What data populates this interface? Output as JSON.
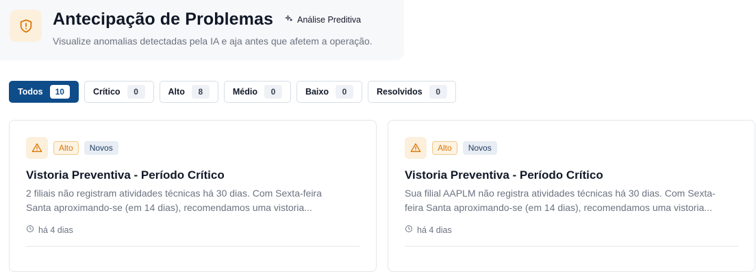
{
  "header": {
    "title": "Antecipação de Problemas",
    "badge": "Análise Preditiva",
    "subtitle": "Visualize anomalias detectadas pela IA e aja antes que afetem a operação.",
    "icon": "shield-alert-icon",
    "accent": "#d97706"
  },
  "filters": [
    {
      "label": "Todos",
      "count": "10",
      "active": true
    },
    {
      "label": "Crítico",
      "count": "0"
    },
    {
      "label": "Alto",
      "count": "8"
    },
    {
      "label": "Médio",
      "count": "0"
    },
    {
      "label": "Baixo",
      "count": "0"
    },
    {
      "label": "Resolvidos",
      "count": "0"
    }
  ],
  "cards": [
    {
      "severity": "Alto",
      "status": "Novos",
      "title": "Vistoria Preventiva - Período Crítico",
      "description": "2 filiais não registram atividades técnicas há 30 dias. Com Sexta-feira Santa aproximando-se (em 14 dias), recomendamos uma vistoria...",
      "time": "há 4 dias"
    },
    {
      "severity": "Alto",
      "status": "Novos",
      "title": "Vistoria Preventiva - Período Crítico",
      "description": "Sua filial AAPLM não registra atividades técnicas há 30 dias. Com Sexta-feira Santa aproximando-se (em 14 dias), recomendamos uma vistoria...",
      "time": "há 4 dias"
    }
  ],
  "colors": {
    "primary": "#0f4c8a",
    "warning": "#d97706",
    "warning_bg": "#fcefdc"
  }
}
